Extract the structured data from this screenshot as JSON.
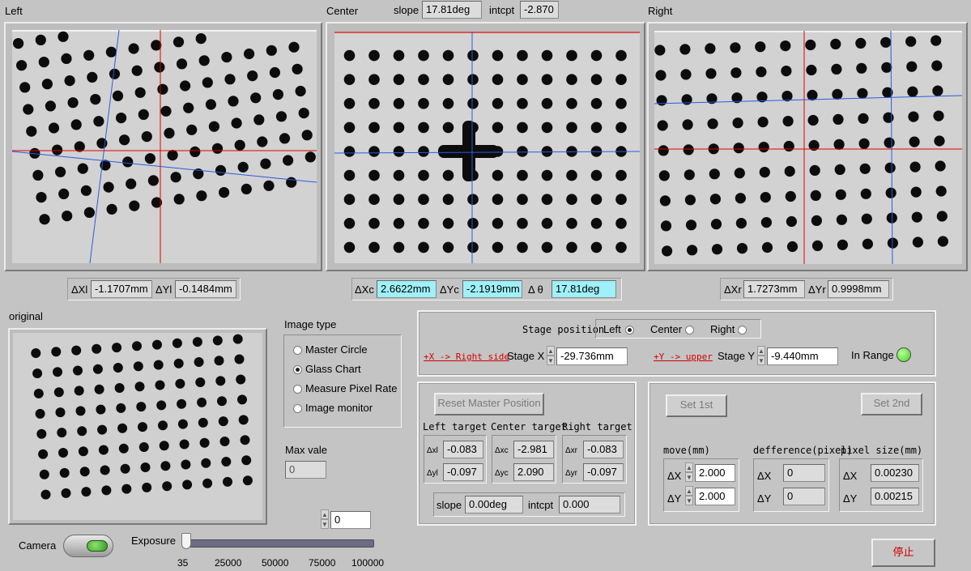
{
  "views": {
    "left_title": "Left",
    "center_title": "Center",
    "right_title": "Right",
    "original_title": "original"
  },
  "line_fit": {
    "slope_label": "slope",
    "slope_value": "17.81deg",
    "intcpt_label": "intcpt",
    "intcpt_value": "-2.870"
  },
  "left_readout": {
    "dx_label": "ΔXl",
    "dx_value": "-1.1707mm",
    "dy_label": "ΔYl",
    "dy_value": "-0.1484mm"
  },
  "center_readout": {
    "dx_label": "ΔXc",
    "dx_value": "2.6622mm",
    "dy_label": "ΔYc",
    "dy_value": "-2.1919mm",
    "dt_label": "Δ θ",
    "dt_value": "17.81deg"
  },
  "right_readout": {
    "dx_label": "ΔXr",
    "dx_value": "1.7273mm",
    "dy_label": "ΔYr",
    "dy_value": "0.9998mm"
  },
  "image_type": {
    "title": "Image type",
    "options": [
      "Master Circle",
      "Glass Chart",
      "Measure Pixel Rate",
      "Image monitor"
    ],
    "selected": "Glass Chart"
  },
  "max_vale": {
    "label": "Max vale",
    "value": "0"
  },
  "stage": {
    "position_label": "Stage position",
    "positions": [
      "Left",
      "Center",
      "Right"
    ],
    "selected": "Left",
    "x_hint": "+X -> Right side",
    "x_label": "Stage X",
    "x_value": "-29.736mm",
    "y_hint": "+Y -> upper",
    "y_label": "Stage Y",
    "y_value": "-9.440mm",
    "in_range_label": "In Range",
    "in_range_color": "#46d21e"
  },
  "master": {
    "reset_label": "Reset Master Position",
    "left_target_label": "Left target",
    "center_target_label": "Center target",
    "right_target_label": "Right target",
    "dxl_label": "Δxl",
    "dxl_value": "-0.083",
    "dyl_label": "Δyl",
    "dyl_value": "-0.097",
    "dxc_label": "Δxc",
    "dxc_value": "-2.981",
    "dyc_label": "Δyc",
    "dyc_value": "2.090",
    "dxr_label": "Δxr",
    "dxr_value": "-0.083",
    "dyr_label": "Δyr",
    "dyr_value": "-0.097",
    "slope_label": "slope",
    "slope_value": "0.00deg",
    "intcpt_label": "intcpt",
    "intcpt_value": "0.000"
  },
  "pixel_rate": {
    "set1_label": "Set 1st",
    "set2_label": "Set 2nd",
    "move_label": "move(mm)",
    "diff_label": "defference(pixel)",
    "size_label": "pixel size(mm)",
    "dx_label": "ΔX",
    "dy_label": "ΔY",
    "move_x": "2.000",
    "move_y": "2.000",
    "diff_x": "0",
    "diff_y": "0",
    "size_x": "0.00230",
    "size_y": "0.00215"
  },
  "camera": {
    "label": "Camera",
    "indicator_color": "#2e9e1c"
  },
  "exposure": {
    "label": "Exposure",
    "value": "0",
    "ticks": [
      "35",
      "25000",
      "50000",
      "75000",
      "100000"
    ],
    "level": 0
  },
  "stop": {
    "label": "停止"
  }
}
